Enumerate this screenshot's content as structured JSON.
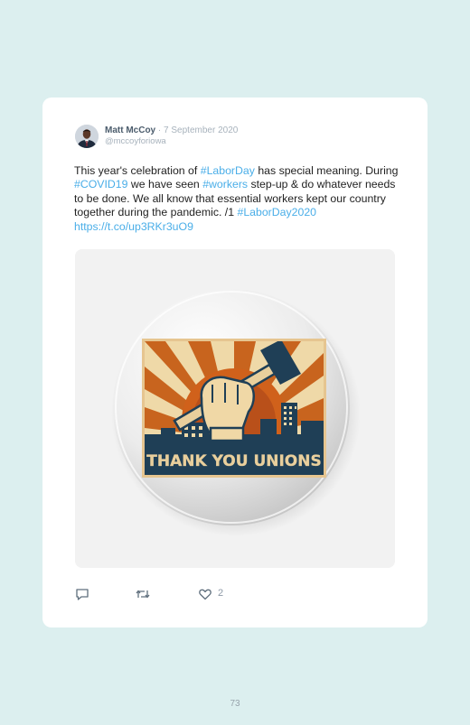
{
  "tweet": {
    "author_name": "Matt McCoy",
    "separator": "·",
    "date": "7 September 2020",
    "handle": "@mccoyforiowa",
    "text": {
      "p1": "This year's celebration of ",
      "tag_laborday": "#LaborDay",
      "p2": " has special meaning. During ",
      "tag_covid": "#COVID19",
      "p3": " we have seen ",
      "tag_workers": "#workers",
      "p4": " step-up & do whatever needs to be done. We all know that essential workers kept our country together during the pandemic. /1 ",
      "tag_laborday2020": "#LaborDay2020",
      "p5": " ",
      "link": "https://t.co/up3RKr3uO9"
    },
    "image": {
      "button_text": "THANK YOU UNIONS"
    },
    "actions": {
      "reply_icon": "reply-icon",
      "retweet_icon": "retweet-icon",
      "like_icon": "heart-icon",
      "like_count": "2"
    }
  },
  "page_number": "73",
  "colors": {
    "background": "#dcefef",
    "hashtag": "#4aaee8",
    "poster_navy": "#1f3f56",
    "poster_orange": "#c8641e"
  }
}
